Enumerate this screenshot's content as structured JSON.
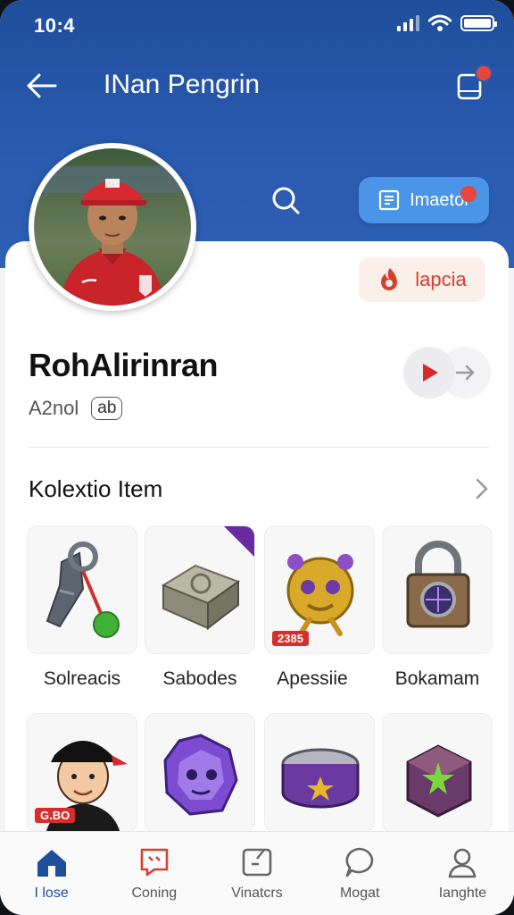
{
  "status_bar": {
    "time": "10:4"
  },
  "header": {
    "title": "INan Pengrin",
    "import_label": "Imaetor"
  },
  "profile": {
    "tag_label": "lapcia",
    "name": "RohAlirinran",
    "sub_text": "A2nol",
    "sub_chip": "ab"
  },
  "collection": {
    "title": "Kolextio Item",
    "items": [
      {
        "label": "Solreacis",
        "icon": "keys-icon"
      },
      {
        "label": "Sabodes",
        "icon": "metal-block-icon"
      },
      {
        "label": "Apessiie",
        "icon": "golden-mask-icon",
        "price": "2385"
      },
      {
        "label": "Bokamam",
        "icon": "padlock-icon"
      },
      {
        "label": "",
        "icon": "cartoon-person-icon",
        "price": "G.BO"
      },
      {
        "label": "",
        "icon": "purple-gem-face-icon"
      },
      {
        "label": "",
        "icon": "star-drum-icon"
      },
      {
        "label": "",
        "icon": "emerald-box-icon"
      }
    ]
  },
  "bottom_nav": [
    {
      "label": "I lose",
      "icon": "home-icon"
    },
    {
      "label": "Coning",
      "icon": "chat-icon"
    },
    {
      "label": "Vinatcrs",
      "icon": "note-icon"
    },
    {
      "label": "Mogat",
      "icon": "message-bubble-icon"
    },
    {
      "label": "Ianghte",
      "icon": "profile-icon"
    }
  ],
  "colors": {
    "header": "#2a5bb0",
    "accent": "#4a95e8",
    "badge": "#e8463a",
    "price": "#d72d2d"
  }
}
